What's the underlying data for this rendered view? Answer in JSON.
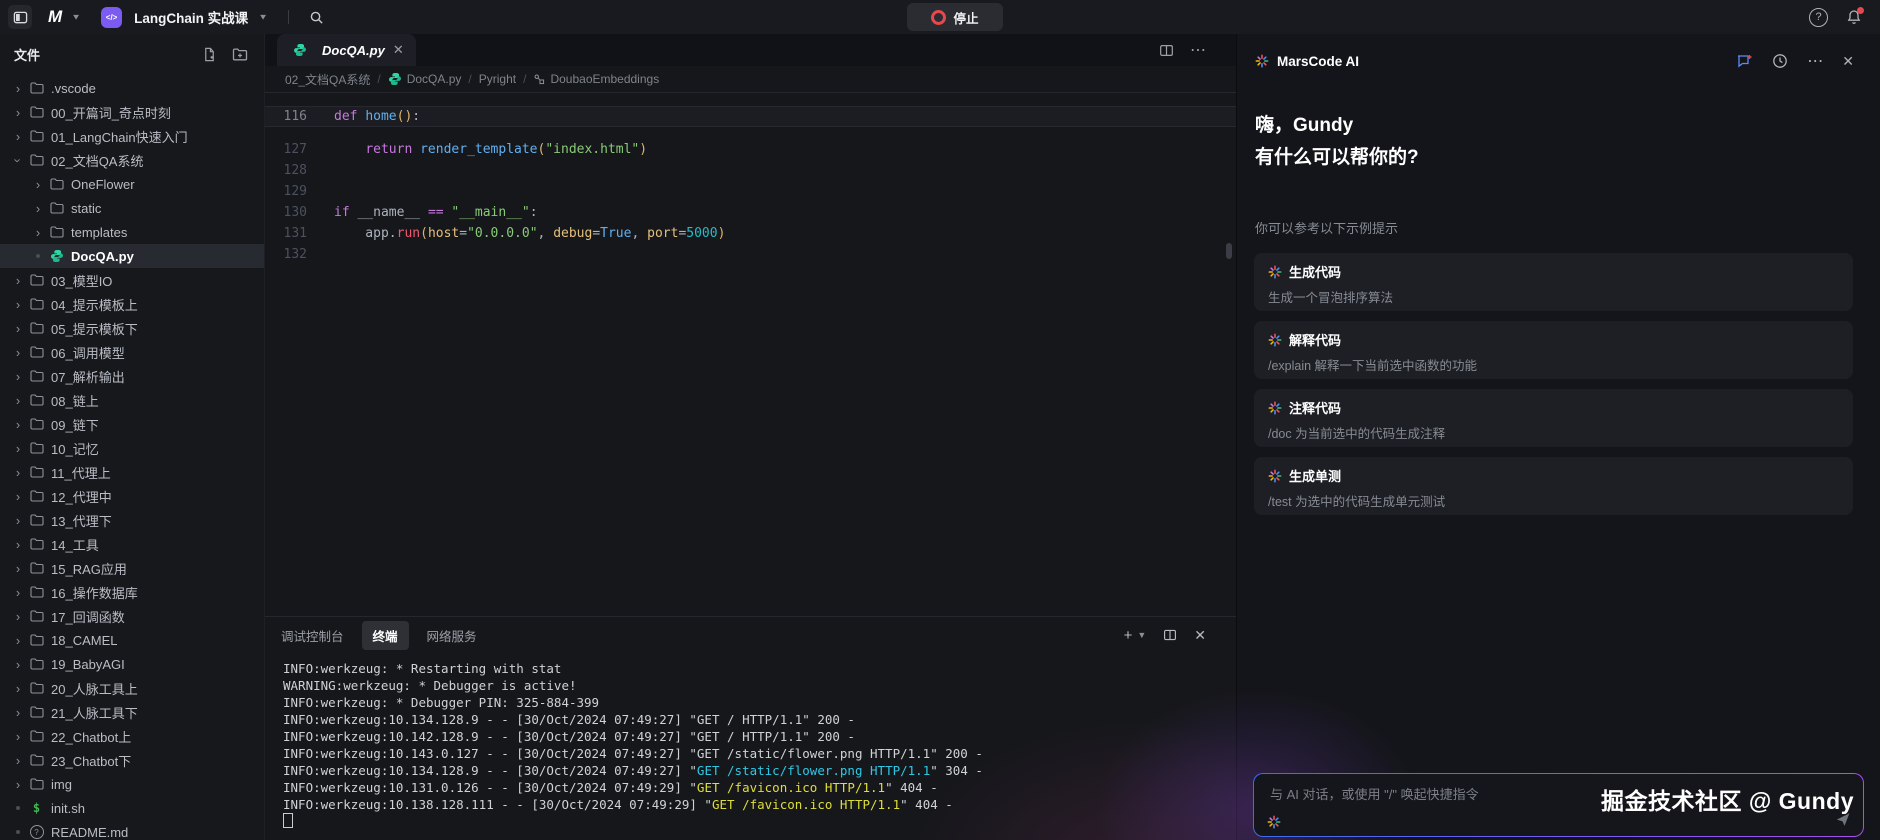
{
  "topbar": {
    "workspace": "LangChain 实战课",
    "stop": "停止"
  },
  "explorer": {
    "title": "文件",
    "items": [
      {
        "label": ".vscode",
        "type": "folder",
        "depth": 0
      },
      {
        "label": "00_开篇词_奇点时刻",
        "type": "folder",
        "depth": 0
      },
      {
        "label": "01_LangChain快速入门",
        "type": "folder",
        "depth": 0
      },
      {
        "label": "02_文档QA系统",
        "type": "folder",
        "depth": 0,
        "expanded": true
      },
      {
        "label": "OneFlower",
        "type": "folder",
        "depth": 1
      },
      {
        "label": "static",
        "type": "folder",
        "depth": 1
      },
      {
        "label": "templates",
        "type": "folder",
        "depth": 1
      },
      {
        "label": "DocQA.py",
        "type": "python",
        "depth": 1,
        "selected": true
      },
      {
        "label": "03_模型IO",
        "type": "folder",
        "depth": 0
      },
      {
        "label": "04_提示模板上",
        "type": "folder",
        "depth": 0
      },
      {
        "label": "05_提示模板下",
        "type": "folder",
        "depth": 0
      },
      {
        "label": "06_调用模型",
        "type": "folder",
        "depth": 0
      },
      {
        "label": "07_解析输出",
        "type": "folder",
        "depth": 0
      },
      {
        "label": "08_链上",
        "type": "folder",
        "depth": 0
      },
      {
        "label": "09_链下",
        "type": "folder",
        "depth": 0
      },
      {
        "label": "10_记忆",
        "type": "folder",
        "depth": 0
      },
      {
        "label": "11_代理上",
        "type": "folder",
        "depth": 0
      },
      {
        "label": "12_代理中",
        "type": "folder",
        "depth": 0
      },
      {
        "label": "13_代理下",
        "type": "folder",
        "depth": 0
      },
      {
        "label": "14_工具",
        "type": "folder",
        "depth": 0
      },
      {
        "label": "15_RAG应用",
        "type": "folder",
        "depth": 0
      },
      {
        "label": "16_操作数据库",
        "type": "folder",
        "depth": 0
      },
      {
        "label": "17_回调函数",
        "type": "folder",
        "depth": 0
      },
      {
        "label": "18_CAMEL",
        "type": "folder",
        "depth": 0
      },
      {
        "label": "19_BabyAGI",
        "type": "folder",
        "depth": 0
      },
      {
        "label": "20_人脉工具上",
        "type": "folder",
        "depth": 0
      },
      {
        "label": "21_人脉工具下",
        "type": "folder",
        "depth": 0
      },
      {
        "label": "22_Chatbot上",
        "type": "folder",
        "depth": 0
      },
      {
        "label": "23_Chatbot下",
        "type": "folder",
        "depth": 0
      },
      {
        "label": "img",
        "type": "folder",
        "depth": 0
      },
      {
        "label": "init.sh",
        "type": "shell",
        "depth": 0
      },
      {
        "label": "README.md",
        "type": "markdown",
        "depth": 0
      }
    ]
  },
  "editor": {
    "tab": "DocQA.py",
    "breadcrumbs": [
      {
        "label": "02_文档QA系统"
      },
      {
        "label": "DocQA.py",
        "icon": "python"
      },
      {
        "label": "Pyright"
      },
      {
        "label": "DoubaoEmbeddings",
        "icon": "symbol"
      }
    ],
    "lines": [
      {
        "num": 116,
        "current": true,
        "fold": true,
        "tokens": [
          {
            "t": "def ",
            "c": "kw"
          },
          {
            "t": "home",
            "c": "fn"
          },
          {
            "t": "()",
            "c": "brk"
          },
          {
            "t": ":"
          }
        ]
      },
      {
        "num": 127,
        "tokens": [
          {
            "t": "    "
          },
          {
            "t": "return ",
            "c": "kw"
          },
          {
            "t": "render_template",
            "c": "fn"
          },
          {
            "t": "(",
            "c": "brk"
          },
          {
            "t": "\"index.html\"",
            "c": "str"
          },
          {
            "t": ")",
            "c": "brk"
          }
        ]
      },
      {
        "num": 128,
        "tokens": []
      },
      {
        "num": 129,
        "tokens": []
      },
      {
        "num": 130,
        "tokens": [
          {
            "t": "if ",
            "c": "kw"
          },
          {
            "t": "__name__ "
          },
          {
            "t": "== ",
            "c": "kw"
          },
          {
            "t": "\"__main__\"",
            "c": "str"
          },
          {
            "t": ":"
          }
        ]
      },
      {
        "num": 131,
        "tokens": [
          {
            "t": "    app"
          },
          {
            "t": "."
          },
          {
            "t": "run",
            "c": "meth"
          },
          {
            "t": "(",
            "c": "brk"
          },
          {
            "t": "host",
            "c": "param"
          },
          {
            "t": "="
          },
          {
            "t": "\"0.0.0.0\"",
            "c": "str"
          },
          {
            "t": ", "
          },
          {
            "t": "debug",
            "c": "param"
          },
          {
            "t": "="
          },
          {
            "t": "True",
            "c": "fn"
          },
          {
            "t": ", "
          },
          {
            "t": "port",
            "c": "param"
          },
          {
            "t": "="
          },
          {
            "t": "5000",
            "c": "const"
          },
          {
            "t": ")",
            "c": "brk"
          }
        ]
      },
      {
        "num": 132,
        "tokens": []
      }
    ]
  },
  "panel": {
    "tabs": [
      {
        "label": "调试控制台"
      },
      {
        "label": "终端",
        "active": true
      },
      {
        "label": "网络服务"
      }
    ],
    "terminal": [
      [
        {
          "t": "INFO:werkzeug: * Restarting with stat"
        }
      ],
      [
        {
          "t": "WARNING:werkzeug: * Debugger is active!"
        }
      ],
      [
        {
          "t": "INFO:werkzeug: * Debugger PIN: 325-884-399"
        }
      ],
      [
        {
          "t": "INFO:werkzeug:10.134.128.9 - - [30/Oct/2024 07:49:27] \"GET / HTTP/1.1\" 200 -"
        }
      ],
      [
        {
          "t": "INFO:werkzeug:10.142.128.9 - - [30/Oct/2024 07:49:27] \"GET / HTTP/1.1\" 200 -"
        }
      ],
      [
        {
          "t": "INFO:werkzeug:10.143.0.127 - - [30/Oct/2024 07:49:27] \"GET /static/flower.png HTTP/1.1\" 200 -"
        }
      ],
      [
        {
          "t": "INFO:werkzeug:10.134.128.9 - - [30/Oct/2024 07:49:27] \""
        },
        {
          "t": "GET /static/flower.png HTTP/1.1",
          "c": "cyan"
        },
        {
          "t": "\" 304 -"
        }
      ],
      [
        {
          "t": "INFO:werkzeug:10.131.0.126 - - [30/Oct/2024 07:49:29] \""
        },
        {
          "t": "GET /favicon.ico HTTP/1.1",
          "c": "yellow"
        },
        {
          "t": "\" 404 -"
        }
      ],
      [
        {
          "t": "INFO:werkzeug:10.138.128.111 - - [30/Oct/2024 07:49:29] \""
        },
        {
          "t": "GET /favicon.ico HTTP/1.1",
          "c": "yellow"
        },
        {
          "t": "\" 404 -"
        }
      ],
      [
        {
          "cursor": true
        }
      ]
    ]
  },
  "assistant": {
    "title": "MarsCode AI",
    "greeting1": "嗨，Gundy",
    "greeting2": "有什么可以帮你的?",
    "hint": "你可以参考以下示例提示",
    "cards": [
      {
        "title": "生成代码",
        "desc": "生成一个冒泡排序算法"
      },
      {
        "title": "解释代码",
        "desc": "/explain 解释一下当前选中函数的功能"
      },
      {
        "title": "注释代码",
        "desc": "/doc 为当前选中的代码生成注释"
      },
      {
        "title": "生成单测",
        "desc": "/test 为选中的代码生成单元测试"
      }
    ],
    "placeholder": "与 AI 对话，或使用 \"/\" 唤起快捷指令",
    "watermark": "掘金技术社区 @ Gundy"
  },
  "colors": {
    "accent_purple": "#7b5bf2",
    "stop_red": "#e5484d",
    "python_teal": "#2fd7a7",
    "terminal_cyan": "#2ec8e6",
    "terminal_yellow": "#dede3a"
  }
}
